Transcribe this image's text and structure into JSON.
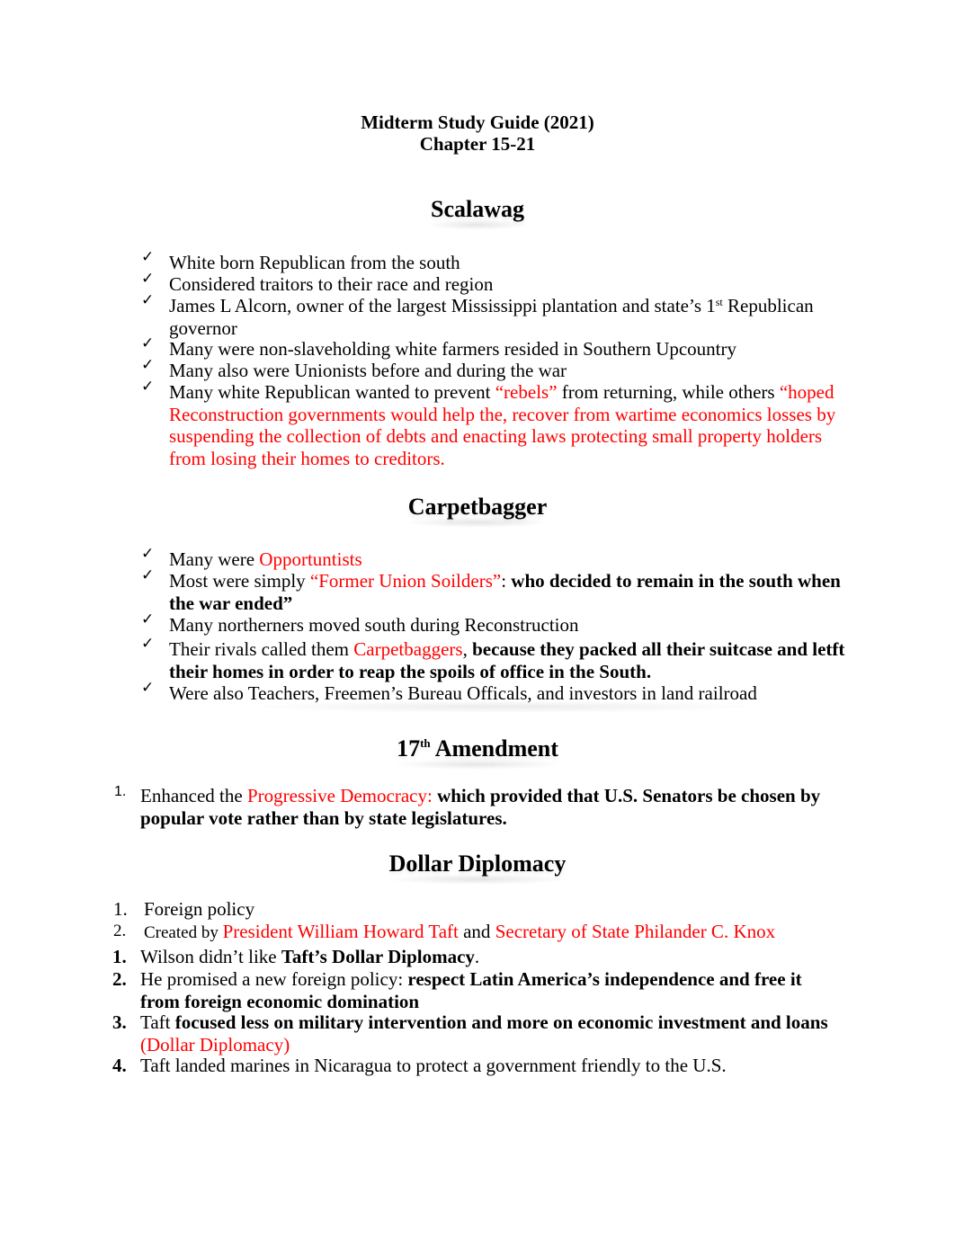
{
  "document": {
    "title_line1": "Midterm Study Guide (2021)",
    "title_line2": "Chapter 15-21",
    "colors": {
      "text": "#000000",
      "highlight": "#ff0000"
    },
    "bullet_icon": "check-mark-icon"
  },
  "scalawag": {
    "heading": "Scalawag",
    "items": [
      {
        "text": "White born Republican from the south"
      },
      {
        "text": "Considered traitors to their race and region"
      },
      {
        "pre": "James L Alcorn, owner of the largest Mississippi plantation and state’s 1",
        "sup": "st",
        "post": " Republican governor"
      },
      {
        "text": "Many were non-slaveholding white farmers resided in Southern Upcountry"
      },
      {
        "text": "Many also were Unionists before and during the war"
      },
      {
        "pre": "Many white Republican wanted to prevent ",
        "red1": "“rebels”",
        "mid": " from returning, while others ",
        "red2": "“hoped Reconstruction governments would help the, recover from wartime economics losses by suspending the collection of debts and enacting laws protecting small property holders from losing their homes to creditors."
      }
    ]
  },
  "carpetbagger": {
    "heading": "Carpetbagger",
    "items": [
      {
        "pre": "Many were ",
        "red": "Opportuntists"
      },
      {
        "pre": "Most were simply ",
        "red": "“Former Union Soilders”",
        "post": ": ",
        "bold": "who decided to remain in the south when the war ended”"
      },
      {
        "text": "Many northerners moved south during Reconstruction"
      },
      {
        "pre": "Their rivals called them ",
        "red": "Carpetbaggers",
        "post": ", ",
        "bold": "because they packed all their suitcase and letft their homes in order to reap the spoils of office in the South."
      },
      {
        "text": "Were also Teachers, Freemen’s Bureau Officals, and investors in land railroad"
      }
    ]
  },
  "amendment": {
    "heading_num": "17",
    "heading_sup": "th",
    "heading_rest": " Amendment",
    "items": [
      {
        "marker": "1.",
        "pre": "Enhanced the ",
        "red": "Progressive Democracy:",
        "bold": " which provided that U.S. Senators be chosen by popular vote rather than by state legislatures."
      }
    ]
  },
  "dollar": {
    "heading": "Dollar Diplomacy",
    "items": [
      {
        "marker": "1.",
        "text": "Foreign policy"
      },
      {
        "marker": "2.",
        "pre": "Created by ",
        "red1": "President William Howard Taft",
        "mid": " and ",
        "red2": "Secretary of State Philander C. Knox"
      },
      {
        "marker": "1.",
        "pre": "Wilson didn’t like ",
        "bold": "Taft’s Dollar Diplomacy",
        "post": "."
      },
      {
        "marker": "2.",
        "pre": "He promised a new foreign policy:  ",
        "bold": "respect Latin America’s independence and free it from foreign economic domination"
      },
      {
        "marker": "3.",
        "pre": "Taft ",
        "bold": "focused less on military intervention and more on economic investment and loans",
        "red": " (Dollar Diplomacy)"
      },
      {
        "marker": "4.",
        "text": "Taft landed marines in Nicaragua to protect a government friendly to the U.S."
      }
    ]
  }
}
